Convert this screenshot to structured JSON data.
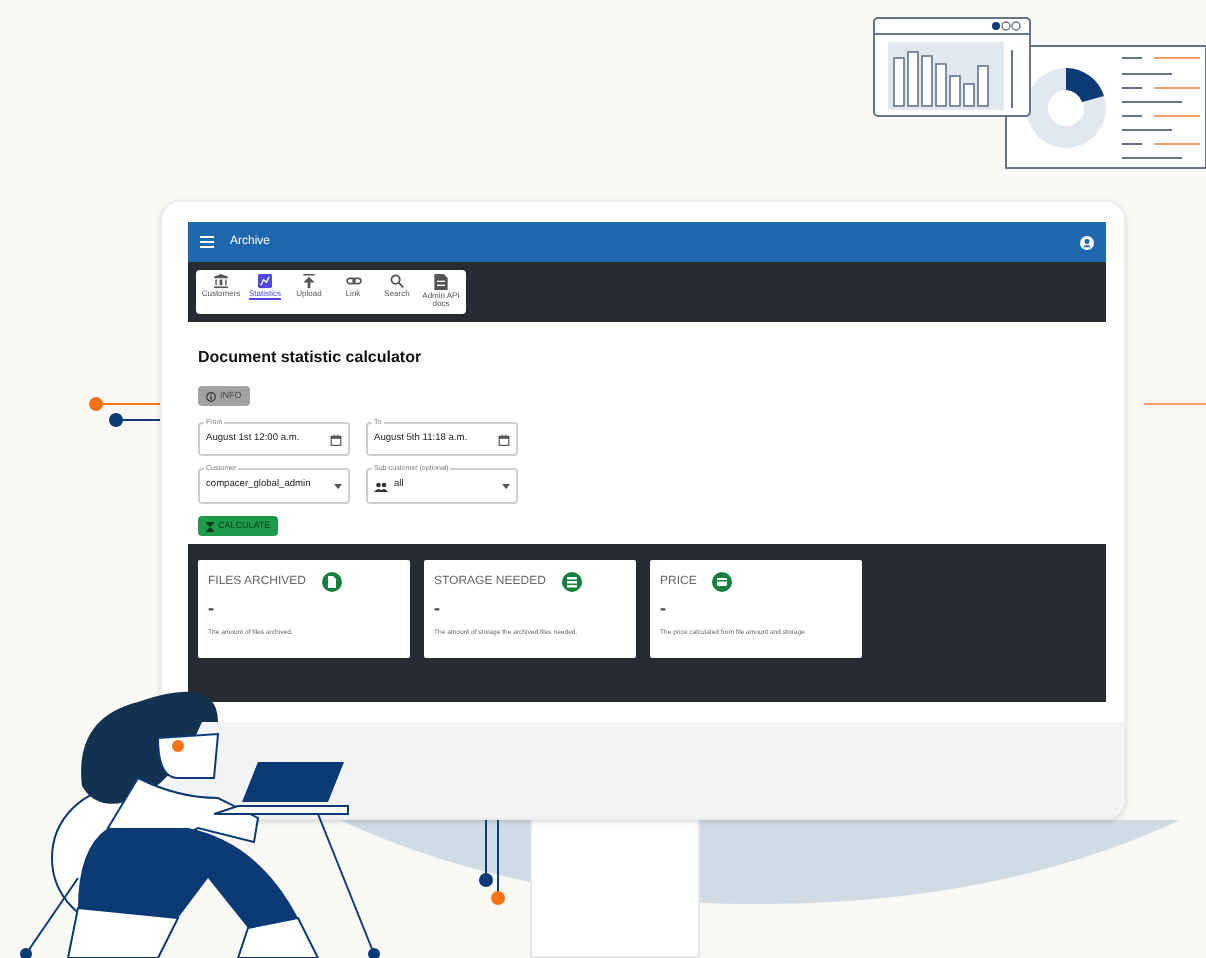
{
  "app_bar": {
    "title": "Archive"
  },
  "nav": [
    {
      "label": "Customers",
      "selected": false,
      "kind": "customers"
    },
    {
      "label": "Statistics",
      "selected": true,
      "kind": "statistics"
    },
    {
      "label": "Upload",
      "selected": false,
      "kind": "upload"
    },
    {
      "label": "Link",
      "selected": false,
      "kind": "link"
    },
    {
      "label": "Search",
      "selected": false,
      "kind": "search"
    },
    {
      "label": "Admin API docs",
      "selected": false,
      "kind": "docs"
    }
  ],
  "heading": "Document statistic calculator",
  "info_button": "INFO",
  "fields": [
    {
      "label": "From",
      "value": "August 1st 12:00 a.m.",
      "kind": "date"
    },
    {
      "label": "To",
      "value": "August 5th 11:18 a.m.",
      "kind": "date"
    },
    {
      "label": "Customer",
      "value": "compacer_global_admin",
      "kind": "select"
    },
    {
      "label": "Sub-customer (optional)",
      "value": "all",
      "kind": "group-select"
    }
  ],
  "calculate_button": "CALCULATE",
  "cards": [
    {
      "title": "FILES ARCHIVED",
      "value": "-",
      "description": "The amount of files archived.",
      "kind": "file"
    },
    {
      "title": "STORAGE NEEDED",
      "value": "-",
      "description": "The amount of storage the archived files needed.",
      "kind": "storage"
    },
    {
      "title": "PRICE",
      "value": "-",
      "description": "The price calculated from file amount and storage.",
      "kind": "price"
    }
  ]
}
